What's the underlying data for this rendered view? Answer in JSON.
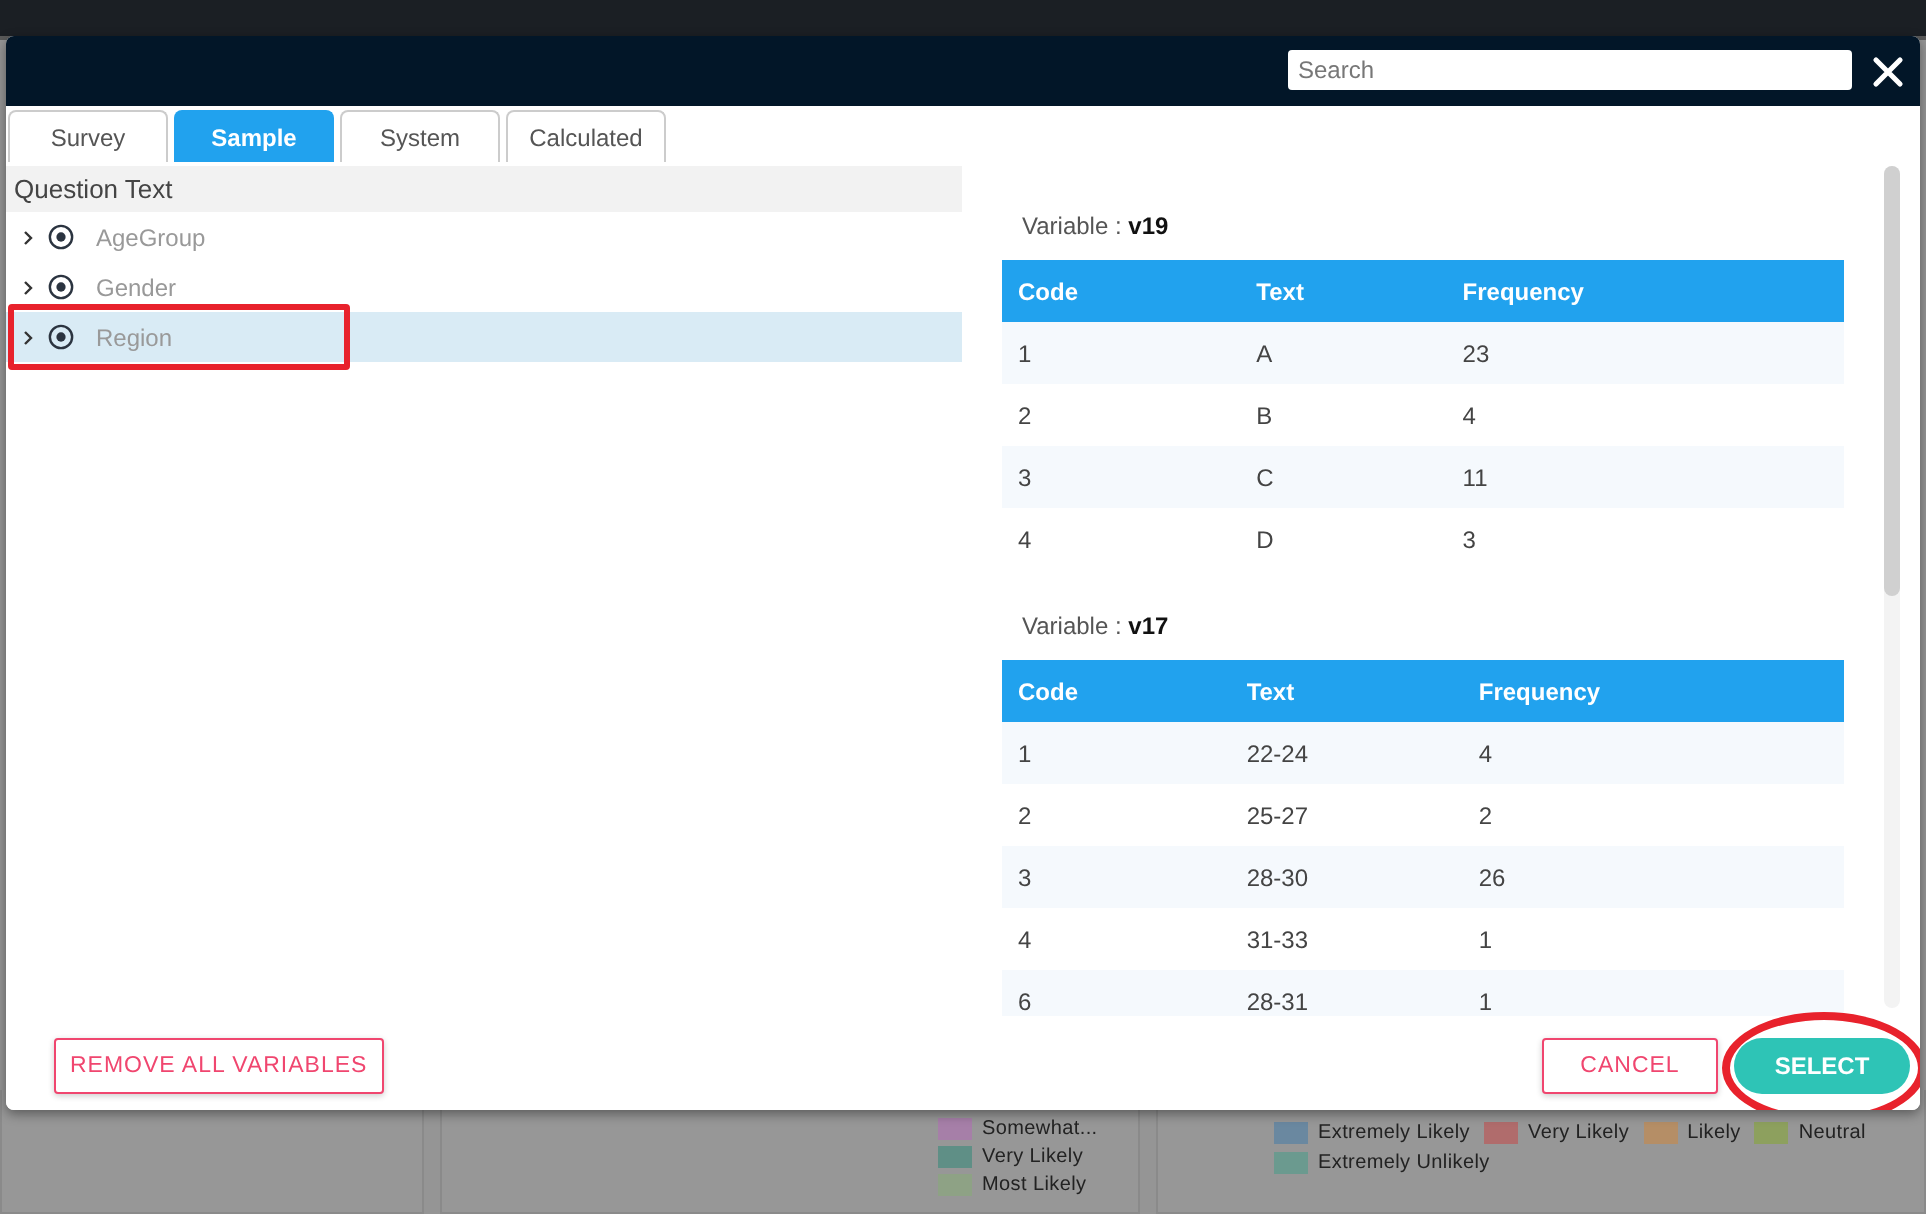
{
  "background": {
    "legends": [
      {
        "items": [
          {
            "label": "Somewhat...",
            "color": "#a67fa8"
          },
          {
            "label": "Very Likely",
            "color": "#5f8f86"
          },
          {
            "label": "Most Likely",
            "color": "#8ea285"
          }
        ]
      },
      {
        "items": [
          {
            "label": "Extremely Likely",
            "color": "#6a88a0"
          },
          {
            "label": "Very Likely",
            "color": "#b06c6c"
          },
          {
            "label": "Likely",
            "color": "#b58e66"
          },
          {
            "label": "Neutral",
            "color": "#8da05e"
          },
          {
            "label": "Extremely Unlikely",
            "color": "#6b9a8f"
          }
        ]
      }
    ]
  },
  "dialog": {
    "search": {
      "placeholder": "Search"
    },
    "tabs": [
      {
        "label": "Survey",
        "selected": false
      },
      {
        "label": "Sample",
        "selected": true
      },
      {
        "label": "System",
        "selected": false
      },
      {
        "label": "Calculated",
        "selected": false
      }
    ],
    "list_header": "Question Text",
    "questions": [
      {
        "label": "AgeGroup",
        "selected": false,
        "highlighted": false
      },
      {
        "label": "Gender",
        "selected": false,
        "highlighted": false
      },
      {
        "label": "Region",
        "selected": true,
        "highlighted": true
      }
    ],
    "variables": [
      {
        "label": "Variable : **v19**",
        "columns": [
          "Code",
          "Text",
          "Frequency"
        ],
        "rows": [
          [
            "1",
            "A",
            "23"
          ],
          [
            "2",
            "B",
            "4"
          ],
          [
            "3",
            "C",
            "11"
          ],
          [
            "4",
            "D",
            "3"
          ]
        ]
      },
      {
        "label": "Variable : **v17**",
        "columns": [
          "Code",
          "Text",
          "Frequency"
        ],
        "rows": [
          [
            "1",
            "22-24",
            "4"
          ],
          [
            "2",
            "25-27",
            "2"
          ],
          [
            "3",
            "28-30",
            "26"
          ],
          [
            "4",
            "31-33",
            "1"
          ],
          [
            "6",
            "28-31",
            "1"
          ]
        ]
      }
    ],
    "footer": {
      "remove": "REMOVE ALL VARIABLES",
      "cancel": "CANCEL",
      "select": {
        "label": "SELECT",
        "circled": true
      }
    }
  }
}
